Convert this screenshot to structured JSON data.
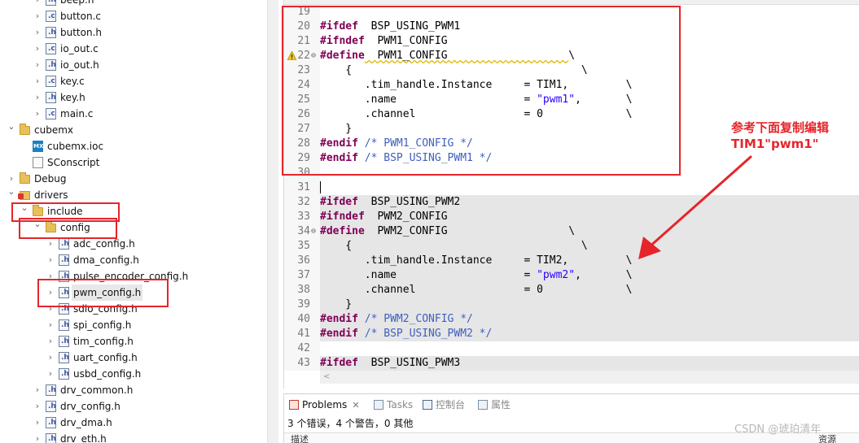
{
  "tree": {
    "rows": [
      {
        "label": "beep.h",
        "icon": "header-file-icon",
        "kind": "file",
        "letter": "h",
        "indent": 3,
        "chevron": "right"
      },
      {
        "label": "button.c",
        "icon": "c-file-icon",
        "kind": "file",
        "letter": "c",
        "indent": 3,
        "chevron": "right"
      },
      {
        "label": "button.h",
        "icon": "header-file-icon",
        "kind": "file",
        "letter": "h",
        "indent": 3,
        "chevron": "right"
      },
      {
        "label": "io_out.c",
        "icon": "c-file-icon",
        "kind": "file",
        "letter": "c",
        "indent": 3,
        "chevron": "right"
      },
      {
        "label": "io_out.h",
        "icon": "header-file-icon",
        "kind": "file",
        "letter": "h",
        "indent": 3,
        "chevron": "right"
      },
      {
        "label": "key.c",
        "icon": "c-file-icon",
        "kind": "file",
        "letter": "c",
        "indent": 3,
        "chevron": "right"
      },
      {
        "label": "key.h",
        "icon": "header-file-icon",
        "kind": "file",
        "letter": "h",
        "indent": 3,
        "chevron": "right"
      },
      {
        "label": "main.c",
        "icon": "c-file-icon",
        "kind": "file",
        "letter": "c",
        "indent": 3,
        "chevron": "right"
      },
      {
        "label": "cubemx",
        "icon": "folder-icon",
        "kind": "folder",
        "indent": 1,
        "chevron": "down"
      },
      {
        "label": "cubemx.ioc",
        "icon": "cubemx-file-icon",
        "kind": "mx",
        "indent": 2,
        "chevron": ""
      },
      {
        "label": "SConscript",
        "icon": "text-file-icon",
        "kind": "plain",
        "indent": 2,
        "chevron": ""
      },
      {
        "label": "Debug",
        "icon": "folder-icon",
        "kind": "folder",
        "indent": 1,
        "chevron": "right"
      },
      {
        "label": "drivers",
        "icon": "driver-folder-icon",
        "kind": "drvfolder",
        "indent": 1,
        "chevron": "down"
      },
      {
        "label": "include",
        "icon": "folder-icon",
        "kind": "folder",
        "indent": 2,
        "chevron": "down"
      },
      {
        "label": "config",
        "icon": "folder-icon",
        "kind": "folder",
        "indent": 3,
        "chevron": "down"
      },
      {
        "label": "adc_config.h",
        "icon": "header-file-icon",
        "kind": "file",
        "letter": "h",
        "indent": 4,
        "chevron": "right"
      },
      {
        "label": "dma_config.h",
        "icon": "header-file-icon",
        "kind": "file",
        "letter": "h",
        "indent": 4,
        "chevron": "right"
      },
      {
        "label": "pulse_encoder_config.h",
        "icon": "header-file-icon",
        "kind": "file",
        "letter": "h",
        "indent": 4,
        "chevron": "right"
      },
      {
        "label": "pwm_config.h",
        "icon": "header-file-icon",
        "kind": "file",
        "letter": "h",
        "indent": 4,
        "chevron": "right",
        "selected": true
      },
      {
        "label": "sdio_config.h",
        "icon": "header-file-icon",
        "kind": "file",
        "letter": "h",
        "indent": 4,
        "chevron": "right"
      },
      {
        "label": "spi_config.h",
        "icon": "header-file-icon",
        "kind": "file",
        "letter": "h",
        "indent": 4,
        "chevron": "right"
      },
      {
        "label": "tim_config.h",
        "icon": "header-file-icon",
        "kind": "file",
        "letter": "h",
        "indent": 4,
        "chevron": "right"
      },
      {
        "label": "uart_config.h",
        "icon": "header-file-icon",
        "kind": "file",
        "letter": "h",
        "indent": 4,
        "chevron": "right"
      },
      {
        "label": "usbd_config.h",
        "icon": "header-file-icon",
        "kind": "file",
        "letter": "h",
        "indent": 4,
        "chevron": "right"
      },
      {
        "label": "drv_common.h",
        "icon": "header-file-icon",
        "kind": "file",
        "letter": "h",
        "indent": 3,
        "chevron": "right"
      },
      {
        "label": "drv_config.h",
        "icon": "header-file-icon",
        "kind": "file",
        "letter": "h",
        "indent": 3,
        "chevron": "right"
      },
      {
        "label": "drv_dma.h",
        "icon": "header-file-icon",
        "kind": "file",
        "letter": "h",
        "indent": 3,
        "chevron": "right"
      },
      {
        "label": "drv_eth.h",
        "icon": "header-file-icon",
        "kind": "file",
        "letter": "h",
        "indent": 3,
        "chevron": "right"
      }
    ]
  },
  "editor": {
    "lines": [
      {
        "n": "19",
        "segs": []
      },
      {
        "n": "20",
        "segs": [
          [
            "kw",
            "#ifdef"
          ],
          [
            "",
            "  BSP_USING_PWM1"
          ]
        ]
      },
      {
        "n": "21",
        "segs": [
          [
            "kw",
            "#ifndef"
          ],
          [
            "",
            "  PWM1_CONFIG"
          ]
        ]
      },
      {
        "n": "22",
        "warn": true,
        "fold": true,
        "segs": [
          [
            "kw",
            "#define"
          ],
          [
            "sq",
            "  PWM1_CONFIG                   "
          ],
          [
            "",
            "\\"
          ]
        ]
      },
      {
        "n": "23",
        "segs": [
          [
            "",
            "    {                                    \\"
          ]
        ]
      },
      {
        "n": "24",
        "segs": [
          [
            "",
            "       .tim_handle.Instance     = TIM1,         \\"
          ]
        ]
      },
      {
        "n": "25",
        "segs": [
          [
            "",
            "       .name                    = "
          ],
          [
            "str",
            "\"pwm1\""
          ],
          [
            "",
            ",       \\"
          ]
        ]
      },
      {
        "n": "26",
        "segs": [
          [
            "",
            "       .channel                 = 0             \\"
          ]
        ]
      },
      {
        "n": "27",
        "segs": [
          [
            "",
            "    }"
          ]
        ]
      },
      {
        "n": "28",
        "segs": [
          [
            "kw",
            "#endif"
          ],
          [
            "cm",
            " /* PWM1_CONFIG */"
          ]
        ]
      },
      {
        "n": "29",
        "segs": [
          [
            "kw",
            "#endif"
          ],
          [
            "cm",
            " /* BSP_USING_PWM1 */"
          ]
        ]
      },
      {
        "n": "30",
        "segs": []
      },
      {
        "n": "31",
        "cursor": true,
        "segs": []
      },
      {
        "n": "32",
        "hl": true,
        "segs": [
          [
            "kw",
            "#ifdef"
          ],
          [
            "",
            "  BSP_USING_PWM2"
          ]
        ]
      },
      {
        "n": "33",
        "hl": true,
        "segs": [
          [
            "kw",
            "#ifndef"
          ],
          [
            "",
            "  PWM2_CONFIG"
          ]
        ]
      },
      {
        "n": "34",
        "hl": true,
        "fold": true,
        "segs": [
          [
            "kw",
            "#define"
          ],
          [
            "",
            "  PWM2_CONFIG                   \\"
          ]
        ]
      },
      {
        "n": "35",
        "hl": true,
        "segs": [
          [
            "",
            "    {                                    \\"
          ]
        ]
      },
      {
        "n": "36",
        "hl": true,
        "segs": [
          [
            "",
            "       .tim_handle.Instance     = TIM2,         \\"
          ]
        ]
      },
      {
        "n": "37",
        "hl": true,
        "segs": [
          [
            "",
            "       .name                    = "
          ],
          [
            "str",
            "\"pwm2\""
          ],
          [
            "",
            ",       \\"
          ]
        ]
      },
      {
        "n": "38",
        "hl": true,
        "segs": [
          [
            "",
            "       .channel                 = 0             \\"
          ]
        ]
      },
      {
        "n": "39",
        "hl": true,
        "segs": [
          [
            "",
            "    }"
          ]
        ]
      },
      {
        "n": "40",
        "hl": true,
        "segs": [
          [
            "kw",
            "#endif"
          ],
          [
            "cm",
            " /* PWM2_CONFIG */"
          ]
        ]
      },
      {
        "n": "41",
        "hl": true,
        "segs": [
          [
            "kw",
            "#endif"
          ],
          [
            "cm",
            " /* BSP_USING_PWM2 */"
          ]
        ]
      },
      {
        "n": "42",
        "segs": []
      },
      {
        "n": "43",
        "hl": true,
        "segs": [
          [
            "kw",
            "#ifdef"
          ],
          [
            "",
            "  BSP_USING_PWM3"
          ]
        ]
      }
    ]
  },
  "panel": {
    "tabs": [
      {
        "label": "Problems",
        "icon": "problems-icon",
        "active": true,
        "close": "✕"
      },
      {
        "label": "Tasks",
        "icon": "tasks-icon"
      },
      {
        "label": "控制台",
        "icon": "console-icon"
      },
      {
        "label": "属性",
        "icon": "properties-icon"
      }
    ],
    "status": "3 个错误，4 个警告，0 其他",
    "col_description": "描述",
    "col_resource": "资源"
  },
  "annotation": {
    "line1": "参考下面复制编辑",
    "line2": "TIM1\"pwm1\"",
    "color": "#e5252b"
  },
  "watermark": "CSDN @琥珀清年"
}
